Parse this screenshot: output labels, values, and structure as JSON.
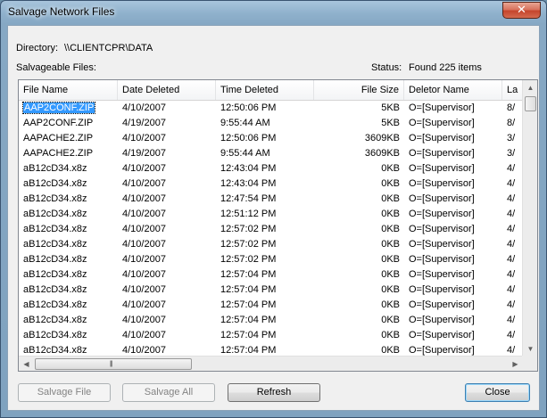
{
  "window": {
    "title": "Salvage Network Files",
    "close_glyph": "✕"
  },
  "directory": {
    "label": "Directory:",
    "value": "\\\\CLIENTCPR\\DATA"
  },
  "files_label": "Salvageable Files:",
  "status": {
    "label": "Status:",
    "value": "Found 225 items"
  },
  "columns": [
    "File Name",
    "Date Deleted",
    "Time Deleted",
    "File Size",
    "Deletor Name",
    "La"
  ],
  "rows": [
    [
      "AAP2CONF.ZIP",
      "4/10/2007",
      "12:50:06 PM",
      "5KB",
      "O=[Supervisor]",
      "8/"
    ],
    [
      "AAP2CONF.ZIP",
      "4/19/2007",
      "9:55:44 AM",
      "5KB",
      "O=[Supervisor]",
      "8/"
    ],
    [
      "AAPACHE2.ZIP",
      "4/10/2007",
      "12:50:06 PM",
      "3609KB",
      "O=[Supervisor]",
      "3/"
    ],
    [
      "AAPACHE2.ZIP",
      "4/19/2007",
      "9:55:44 AM",
      "3609KB",
      "O=[Supervisor]",
      "3/"
    ],
    [
      "aB12cD34.x8z",
      "4/10/2007",
      "12:43:04 PM",
      "0KB",
      "O=[Supervisor]",
      "4/"
    ],
    [
      "aB12cD34.x8z",
      "4/10/2007",
      "12:43:04 PM",
      "0KB",
      "O=[Supervisor]",
      "4/"
    ],
    [
      "aB12cD34.x8z",
      "4/10/2007",
      "12:47:54 PM",
      "0KB",
      "O=[Supervisor]",
      "4/"
    ],
    [
      "aB12cD34.x8z",
      "4/10/2007",
      "12:51:12 PM",
      "0KB",
      "O=[Supervisor]",
      "4/"
    ],
    [
      "aB12cD34.x8z",
      "4/10/2007",
      "12:57:02 PM",
      "0KB",
      "O=[Supervisor]",
      "4/"
    ],
    [
      "aB12cD34.x8z",
      "4/10/2007",
      "12:57:02 PM",
      "0KB",
      "O=[Supervisor]",
      "4/"
    ],
    [
      "aB12cD34.x8z",
      "4/10/2007",
      "12:57:02 PM",
      "0KB",
      "O=[Supervisor]",
      "4/"
    ],
    [
      "aB12cD34.x8z",
      "4/10/2007",
      "12:57:04 PM",
      "0KB",
      "O=[Supervisor]",
      "4/"
    ],
    [
      "aB12cD34.x8z",
      "4/10/2007",
      "12:57:04 PM",
      "0KB",
      "O=[Supervisor]",
      "4/"
    ],
    [
      "aB12cD34.x8z",
      "4/10/2007",
      "12:57:04 PM",
      "0KB",
      "O=[Supervisor]",
      "4/"
    ],
    [
      "aB12cD34.x8z",
      "4/10/2007",
      "12:57:04 PM",
      "0KB",
      "O=[Supervisor]",
      "4/"
    ],
    [
      "aB12cD34.x8z",
      "4/10/2007",
      "12:57:04 PM",
      "0KB",
      "O=[Supervisor]",
      "4/"
    ],
    [
      "aB12cD34.x8z",
      "4/10/2007",
      "12:57:04 PM",
      "0KB",
      "O=[Supervisor]",
      "4/"
    ]
  ],
  "selected_row": 0,
  "scroll": {
    "up": "▲",
    "down": "▼",
    "left": "◀",
    "right": "▶",
    "grip": "|||"
  },
  "buttons": {
    "salvage_file": "Salvage File",
    "salvage_all": "Salvage All",
    "refresh": "Refresh",
    "close": "Close"
  }
}
